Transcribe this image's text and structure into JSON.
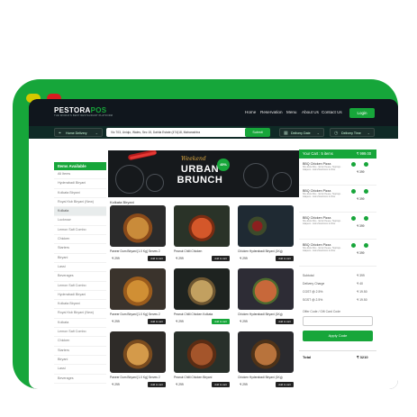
{
  "brand": {
    "name_main": "PESTORA",
    "name_accent": "POS",
    "tagline": "THE WORLD'S BEST RESTAURANT PLATFORM"
  },
  "nav": {
    "links": [
      "Home",
      "Reservation",
      "Menu",
      "About Us",
      "Contact Us"
    ],
    "login": "Login"
  },
  "search": {
    "delivery_type": "Home Delivery",
    "address": "Vic 703, Uniqlo, Wales, Sec 15, Dahlia Estate (474)18, Maharashtra",
    "submit": "Submit",
    "delivery_date": "Delivery Date",
    "delivery_time": "Delivery Time"
  },
  "sidebar": {
    "title": "Items Available",
    "items": [
      "All Items",
      "Hyderabadi Biryani",
      "Kolkata Biryani",
      "Royal Ksb Biryani (New)",
      "Kolkata",
      "Lucknow",
      "Lemon Salt Combo",
      "Chicken",
      "Starters",
      "Biryani",
      "Lassi",
      "Beverages",
      "Lemon Salt Combo",
      "Hyderabadi Biryani",
      "Kolkata Biryani",
      "Royal Ksb Biryani (New)",
      "Kolkata",
      "Lemon Salt Combo",
      "Chicken",
      "Starters",
      "Biryani",
      "Lassi",
      "Beverages"
    ],
    "active_index": 4
  },
  "banner": {
    "script": "Weekend",
    "line1": "URBAN",
    "line2": "BRUNCH",
    "badge": "45%"
  },
  "category_title": "Kolkata Biryani",
  "products": [
    {
      "name": "Paneer Dum Biryani [1.0 Kg] Serves 2",
      "price": "₹ 299",
      "btn": "Add to cart",
      "green": false
    },
    {
      "name": "Peanut Chilli Chicken",
      "price": "₹ 299",
      "btn": "Add to cart",
      "green": false
    },
    {
      "name": "Chicken Hyderabadi Biryani (1Kg)",
      "price": "₹ 299",
      "btn": "Add to cart",
      "green": false
    },
    {
      "name": "Paneer Dum Biryani [1.0 Kg] Serves 2",
      "price": "₹ 299",
      "btn": "Add to cart",
      "green": false
    },
    {
      "name": "Peanut Chilli Chicken Kolkata",
      "price": "₹ 299",
      "btn": "Add to cart",
      "green": true
    },
    {
      "name": "Chicken Hyderabadi Biryani (1Kg)",
      "price": "₹ 299",
      "btn": "Add to cart",
      "green": false
    },
    {
      "name": "Paneer Dum Biryani [1.0 Kg] Serves 2",
      "price": "₹ 299",
      "btn": "Add to cart",
      "green": false
    },
    {
      "name": "Peanut Chilli Chicken Biryani",
      "price": "₹ 299",
      "btn": "Add to cart",
      "green": false
    },
    {
      "name": "Chicken Hyderabadi Biryani (1Kg)",
      "price": "₹ 299",
      "btn": "Add to cart",
      "green": false
    }
  ],
  "cart": {
    "title": "Your Cart : 5 items",
    "amount": "₹ 999.00",
    "items": [
      {
        "name": "BBQ Chicken Pizza",
        "desc": "Size Extra Size · Extra Cheese, Toppings · Jalapeno · Extra Mushroom & Olive",
        "price": "₹ 399"
      },
      {
        "name": "BBQ Chicken Pizza",
        "desc": "Size Extra Size · Extra Cheese, Toppings · Jalapeno · Extra Mushroom & Olive",
        "price": "₹ 399"
      },
      {
        "name": "BBQ Chicken Pizza",
        "desc": "Size Extra Size · Extra Cheese, Toppings · Jalapeno · Extra Mushroom & Olive",
        "price": "₹ 399"
      },
      {
        "name": "BBQ Chicken Pizza",
        "desc": "Size Extra Size · Extra Cheese, Toppings · Jalapeno · Extra Mushroom & Olive",
        "price": "₹ 399"
      }
    ],
    "summary": [
      {
        "label": "Subtotal",
        "value": "₹ 399"
      },
      {
        "label": "Delivery Charge",
        "value": "₹ 40"
      },
      {
        "label": "CGST @ 2.5%",
        "value": "₹ 19.50"
      },
      {
        "label": "SGST @ 2.5%",
        "value": "₹ 19.50"
      }
    ],
    "offer_label": "Offer Code / Gift Card Code",
    "apply": "Apply Code",
    "total_label": "Total",
    "total_value": "₹ 3210"
  },
  "colors": {
    "brand_green": "#17a63a",
    "frame_dark": "#121a22"
  }
}
